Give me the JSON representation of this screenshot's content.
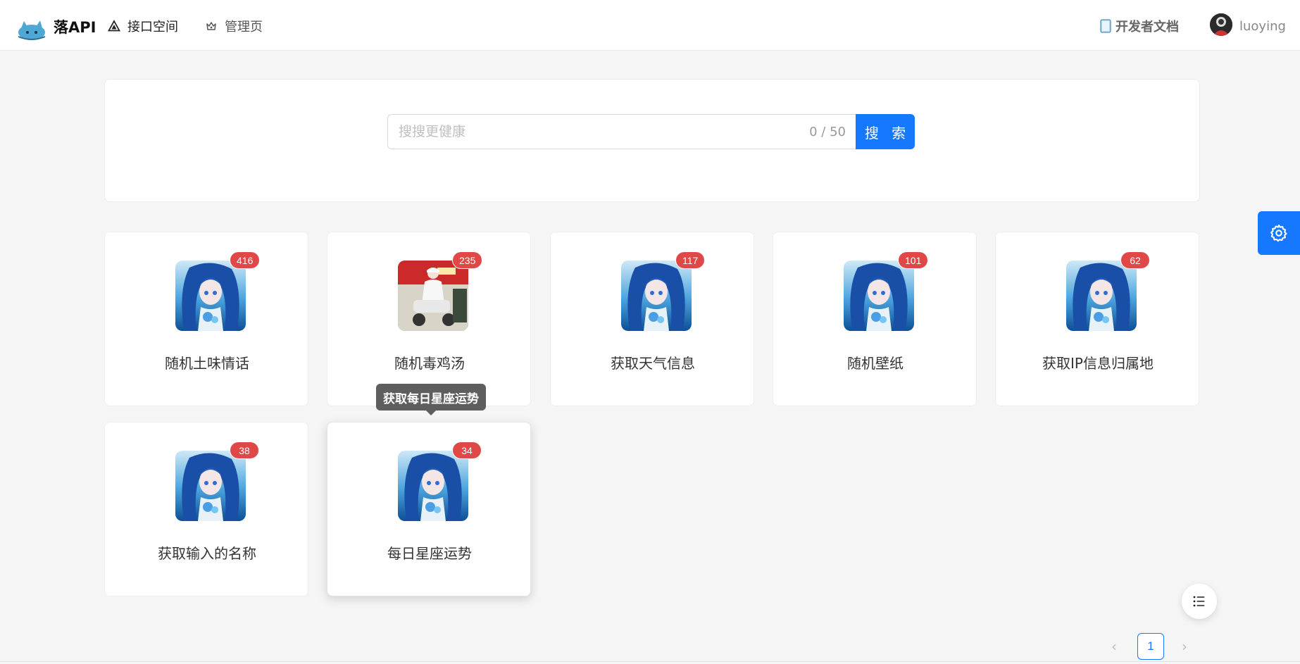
{
  "header": {
    "brand": "落API",
    "nav": [
      {
        "label": "接口空间",
        "icon": "triangle-icon"
      },
      {
        "label": "管理页",
        "icon": "crown-icon"
      }
    ],
    "docs_label": "开发者文档",
    "username": "luoying"
  },
  "search": {
    "placeholder": "搜搜更健康",
    "value": "",
    "char_count": "0 / 50",
    "button_label": "搜 索"
  },
  "apis": [
    {
      "name": "随机土味情话",
      "count": "416",
      "thumb": "anime-girl"
    },
    {
      "name": "随机毒鸡汤",
      "count": "235",
      "thumb": "photo-person-scooter"
    },
    {
      "name": "获取天气信息",
      "count": "117",
      "thumb": "anime-girl"
    },
    {
      "name": "随机壁纸",
      "count": "101",
      "thumb": "anime-girl"
    },
    {
      "name": "获取IP信息归属地",
      "count": "62",
      "thumb": "anime-girl"
    },
    {
      "name": "获取输入的名称",
      "count": "38",
      "thumb": "anime-girl"
    },
    {
      "name": "每日星座运势",
      "count": "34",
      "thumb": "anime-girl"
    }
  ],
  "tooltip": "获取每日星座运势",
  "pagination": {
    "current": "1",
    "prev": "‹",
    "next": "›"
  },
  "colors": {
    "primary": "#1677ff",
    "badge": "#e04848"
  }
}
